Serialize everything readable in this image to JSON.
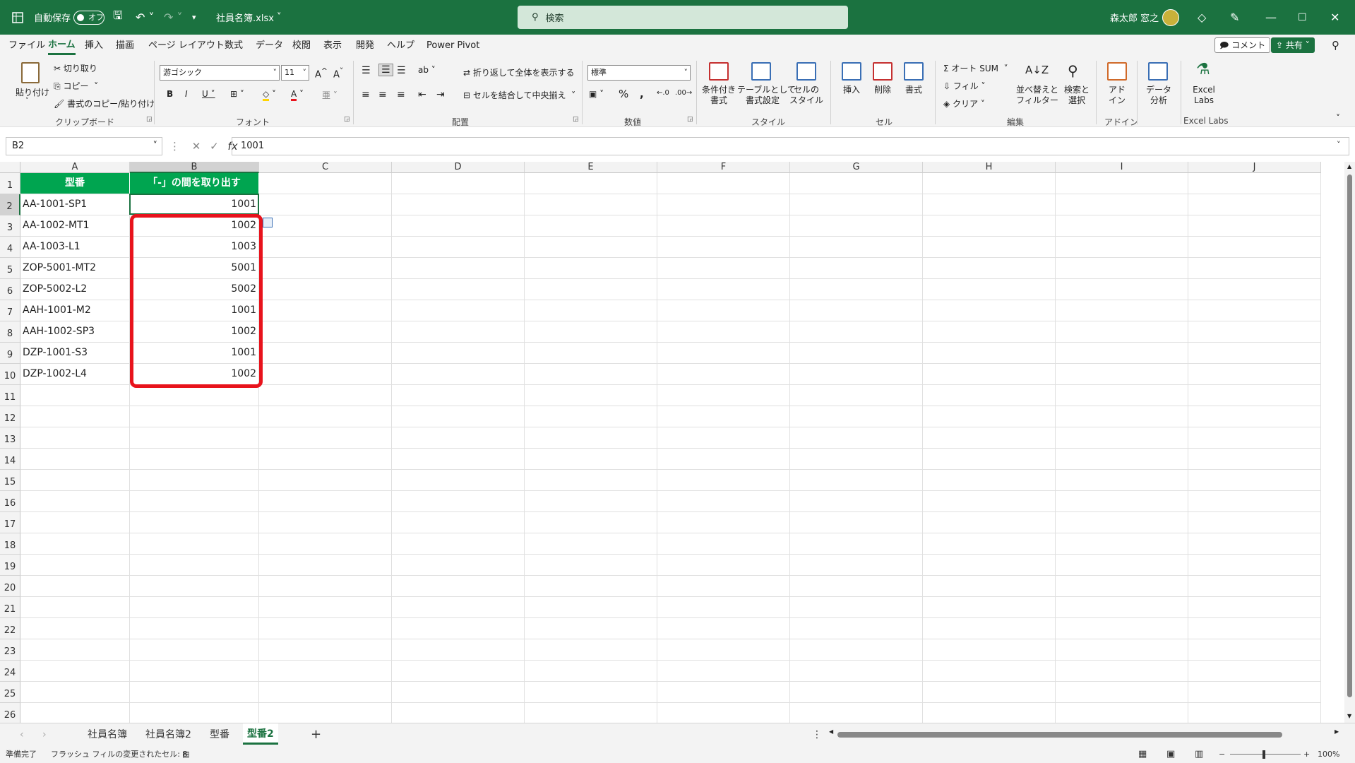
{
  "titlebar": {
    "autosave_label": "自動保存",
    "autosave_state": "オフ",
    "filename": "社員名簿.xlsx",
    "search_placeholder": "検索",
    "user_name": "森太郎 窓之"
  },
  "menu": {
    "items": [
      "ファイル",
      "ホーム",
      "挿入",
      "描画",
      "ページ レイアウト",
      "数式",
      "データ",
      "校閲",
      "表示",
      "開発",
      "ヘルプ",
      "Power Pivot"
    ],
    "active": "ホーム",
    "comment_label": "コメント",
    "share_label": "共有"
  },
  "ribbon": {
    "clipboard": {
      "paste": "貼り付け",
      "cut": "切り取り",
      "copy": "コピー",
      "format_painter": "書式のコピー/貼り付け",
      "group": "クリップボード"
    },
    "font": {
      "name": "游ゴシック",
      "size": "11",
      "group": "フォント"
    },
    "alignment": {
      "wrap": "折り返して全体を表示する",
      "merge": "セルを結合して中央揃え",
      "group": "配置"
    },
    "number": {
      "format": "標準",
      "group": "数値"
    },
    "styles": {
      "conditional": "条件付き\n書式",
      "table": "テーブルとして\n書式設定",
      "cell_styles": "セルの\nスタイル",
      "group": "スタイル"
    },
    "cells": {
      "insert": "挿入",
      "delete": "削除",
      "format": "書式",
      "group": "セル"
    },
    "editing": {
      "autosum": "オート SUM",
      "fill": "フィル",
      "clear": "クリア",
      "sort_filter": "並べ替えと\nフィルター",
      "find_select": "検索と\n選択",
      "group": "編集"
    },
    "addins": {
      "addin": "アド\nイン",
      "group": "アドイン"
    },
    "analysis": {
      "data_analysis": "データ\n分析"
    },
    "excel_labs": {
      "label": "Excel\nLabs",
      "group": "Excel Labs"
    }
  },
  "formula_bar": {
    "name_box": "B2",
    "fx": "fx",
    "value": "1001"
  },
  "columns": [
    "A",
    "B",
    "C",
    "D",
    "E",
    "F",
    "G",
    "H",
    "I",
    "J"
  ],
  "rows": [
    "1",
    "2",
    "3",
    "4",
    "5",
    "6",
    "7",
    "8",
    "9",
    "10",
    "11",
    "12",
    "13",
    "14",
    "15",
    "16",
    "17",
    "18",
    "19",
    "20",
    "21",
    "22",
    "23",
    "24",
    "25",
    "26"
  ],
  "table": {
    "headers": [
      "型番",
      "「-」の間を取り出す"
    ],
    "data": [
      [
        "AA-1001-SP1",
        "1001"
      ],
      [
        "AA-1002-MT1",
        "1002"
      ],
      [
        "AA-1003-L1",
        "1003"
      ],
      [
        "ZOP-5001-MT2",
        "5001"
      ],
      [
        "ZOP-5002-L2",
        "5002"
      ],
      [
        "AAH-1001-M2",
        "1001"
      ],
      [
        "AAH-1002-SP3",
        "1002"
      ],
      [
        "DZP-1001-S3",
        "1001"
      ],
      [
        "DZP-1002-L4",
        "1002"
      ]
    ]
  },
  "sheets": {
    "tabs": [
      "社員名簿",
      "社員名簿2",
      "型番",
      "型番2"
    ],
    "active": "型番2",
    "add": "+"
  },
  "statusbar": {
    "ready": "準備完了",
    "flash_fill": "フラッシュ フィルの変更されたセル: 8",
    "zoom": "100%"
  },
  "colors": {
    "brand": "#1b7240",
    "header_fill": "#00a550",
    "highlight": "#e8131c"
  }
}
